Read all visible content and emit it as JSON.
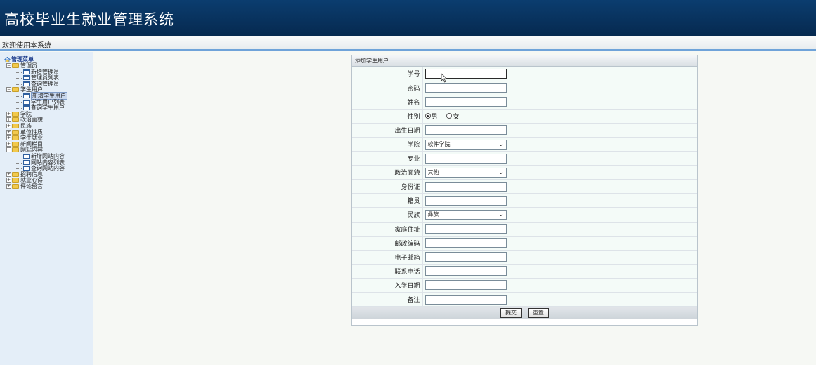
{
  "header": {
    "title": "高校毕业生就业管理系统"
  },
  "welcome": {
    "text": "欢迎使用本系统"
  },
  "sidebar": {
    "root": "管理菜单",
    "groups": [
      {
        "label": "管理员",
        "expanded": true,
        "items": [
          "新增管理员",
          "管理员列表",
          "查询管理员"
        ]
      },
      {
        "label": "学生用户",
        "expanded": true,
        "items": [
          "新增学生用户",
          "学生用户列表",
          "查询学生用户"
        ]
      },
      {
        "label": "学院",
        "expanded": false,
        "items": []
      },
      {
        "label": "政治面貌",
        "expanded": false,
        "items": []
      },
      {
        "label": "民族",
        "expanded": false,
        "items": []
      },
      {
        "label": "单位性质",
        "expanded": false,
        "items": []
      },
      {
        "label": "学生就业",
        "expanded": false,
        "items": []
      },
      {
        "label": "新闻栏目",
        "expanded": false,
        "items": []
      },
      {
        "label": "网站内容",
        "expanded": true,
        "items": [
          "新增网站内容",
          "网站内容列表",
          "查询网站内容"
        ]
      },
      {
        "label": "招聘信息",
        "expanded": false,
        "items": []
      },
      {
        "label": "就业心得",
        "expanded": false,
        "items": []
      },
      {
        "label": "评论留言",
        "expanded": false,
        "items": []
      }
    ],
    "selected": "新增学生用户"
  },
  "form": {
    "title": "添加学生用户",
    "fields": {
      "student_id": {
        "label": "学号",
        "value": ""
      },
      "password": {
        "label": "密码",
        "value": ""
      },
      "name": {
        "label": "姓名",
        "value": ""
      },
      "gender": {
        "label": "性别",
        "options": [
          "男",
          "女"
        ],
        "selected": "男"
      },
      "birthdate": {
        "label": "出生日期",
        "value": ""
      },
      "college": {
        "label": "学院",
        "value": "软件学院"
      },
      "major": {
        "label": "专业",
        "value": ""
      },
      "political": {
        "label": "政治面貌",
        "value": "其他"
      },
      "id_card": {
        "label": "身份证",
        "value": ""
      },
      "native_place": {
        "label": "籍贯",
        "value": ""
      },
      "ethnicity": {
        "label": "民族",
        "value": "彝族"
      },
      "address": {
        "label": "家庭住址",
        "value": ""
      },
      "postcode": {
        "label": "邮政编码",
        "value": ""
      },
      "email": {
        "label": "电子邮箱",
        "value": ""
      },
      "phone": {
        "label": "联系电话",
        "value": ""
      },
      "enroll_date": {
        "label": "入学日期",
        "value": ""
      },
      "remark": {
        "label": "备注",
        "value": ""
      }
    },
    "submit_label": "提交",
    "reset_label": "重置"
  }
}
